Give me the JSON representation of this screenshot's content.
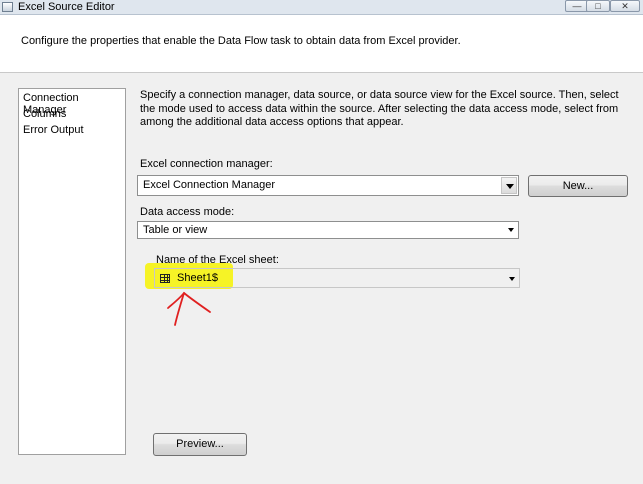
{
  "window": {
    "title": "Excel Source Editor",
    "minimize_label": "—",
    "maximize_label": "□",
    "close_label": "✕"
  },
  "header": {
    "text": "Configure the properties that enable the Data Flow task to obtain data from Excel provider."
  },
  "nav": {
    "items": [
      "Connection Manager",
      "Columns",
      "Error Output"
    ],
    "selected": "Connection Manager"
  },
  "main": {
    "description": "Specify a connection manager, data source, or data source view for the Excel source. Then, select the mode used to access data within the source. After selecting the data access mode, select from among the additional data access options that appear.",
    "connection_manager_label": "Excel connection manager:",
    "connection_manager_value": "Excel Connection Manager",
    "new_button": "New...",
    "access_mode_label": "Data access mode:",
    "access_mode_value": "Table or view",
    "sheet_label": "Name of the Excel sheet:",
    "sheet_value": "Sheet1$",
    "preview_button": "Preview..."
  },
  "annotations": {
    "highlight_color": "#f5f21a",
    "arrow_color": "#e02020"
  }
}
